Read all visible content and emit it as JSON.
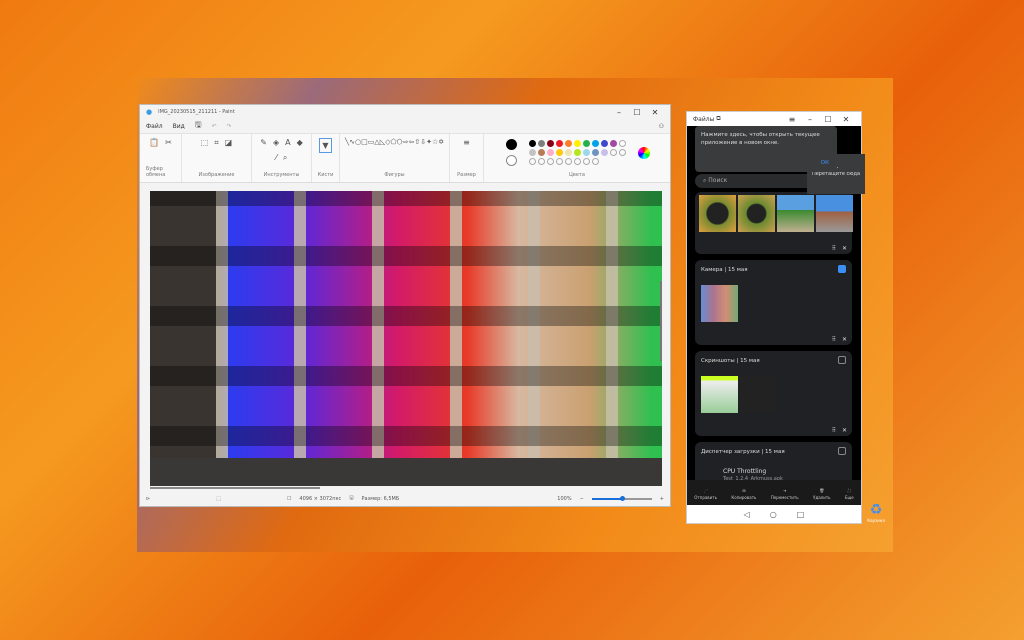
{
  "paint": {
    "title": "IMG_20230515_211211 - Paint",
    "menu": [
      "Файл",
      "Вид"
    ],
    "groups": [
      "Буфер обмена",
      "Изображение",
      "Инструменты",
      "Кисти",
      "Фигуры",
      "Размер",
      "Цвета"
    ],
    "status": {
      "dimensions": "4096 × 3072пкс",
      "size": "Размер: 6,5МБ",
      "zoom": "100%"
    },
    "zoom_slider": 0.5,
    "colors": [
      "#000000",
      "#7f7f7f",
      "#880015",
      "#ed1c24",
      "#ff7f27",
      "#fff200",
      "#22b14c",
      "#00a2e8",
      "#3f48cc",
      "#a349a4",
      "#ffffff",
      "#c3c3c3",
      "#b97a57",
      "#ffaec9",
      "#ffc90e",
      "#efe4b0",
      "#b5e61d",
      "#99d9ea",
      "#7092be",
      "#c8bfe7"
    ]
  },
  "files": {
    "title": "Файлы",
    "tooltip": "Нажмите здесь, чтобы открыть текущее приложение в новом окне.",
    "tooltip_ok": "ОК",
    "search_placeholder": "Поиск",
    "drag_hint": "Перетащите сюда",
    "sections": [
      {
        "title": "Камера | 15 мая",
        "checked": true
      },
      {
        "title": "Скриншоты | 15 мая",
        "checked": false
      },
      {
        "title": "Диспетчер загрузки | 15 мая",
        "checked": false
      }
    ],
    "download_item": {
      "name": "CPU Throttling",
      "sub": "Test_1.2.4_Arkmuss.apk"
    },
    "actions": [
      "Отправить",
      "Копировать",
      "Переместить",
      "Удалить",
      "Еще"
    ]
  },
  "desktop": {
    "recycle_bin": "Корзина"
  }
}
